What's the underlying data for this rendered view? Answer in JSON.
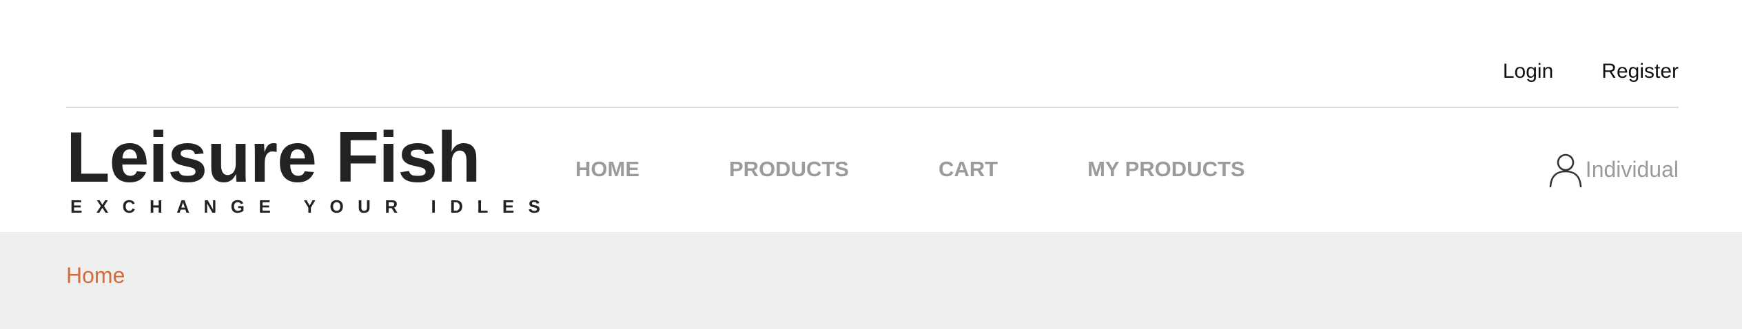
{
  "top_links": {
    "login": "Login",
    "register": "Register"
  },
  "logo": {
    "title": "Leisure Fish",
    "tagline": "EXCHANGE YOUR IDLES"
  },
  "nav": {
    "items": [
      "HOME",
      "PRODUCTS",
      "CART",
      "MY PRODUCTS"
    ]
  },
  "user": {
    "label": "Individual",
    "icon": "user-icon"
  },
  "breadcrumb": {
    "current": "Home"
  },
  "colors": {
    "accent": "#d56a3a",
    "nav_text": "#9b9b9b",
    "text_dark": "#222222",
    "breadcrumb_bg": "#efefef"
  }
}
